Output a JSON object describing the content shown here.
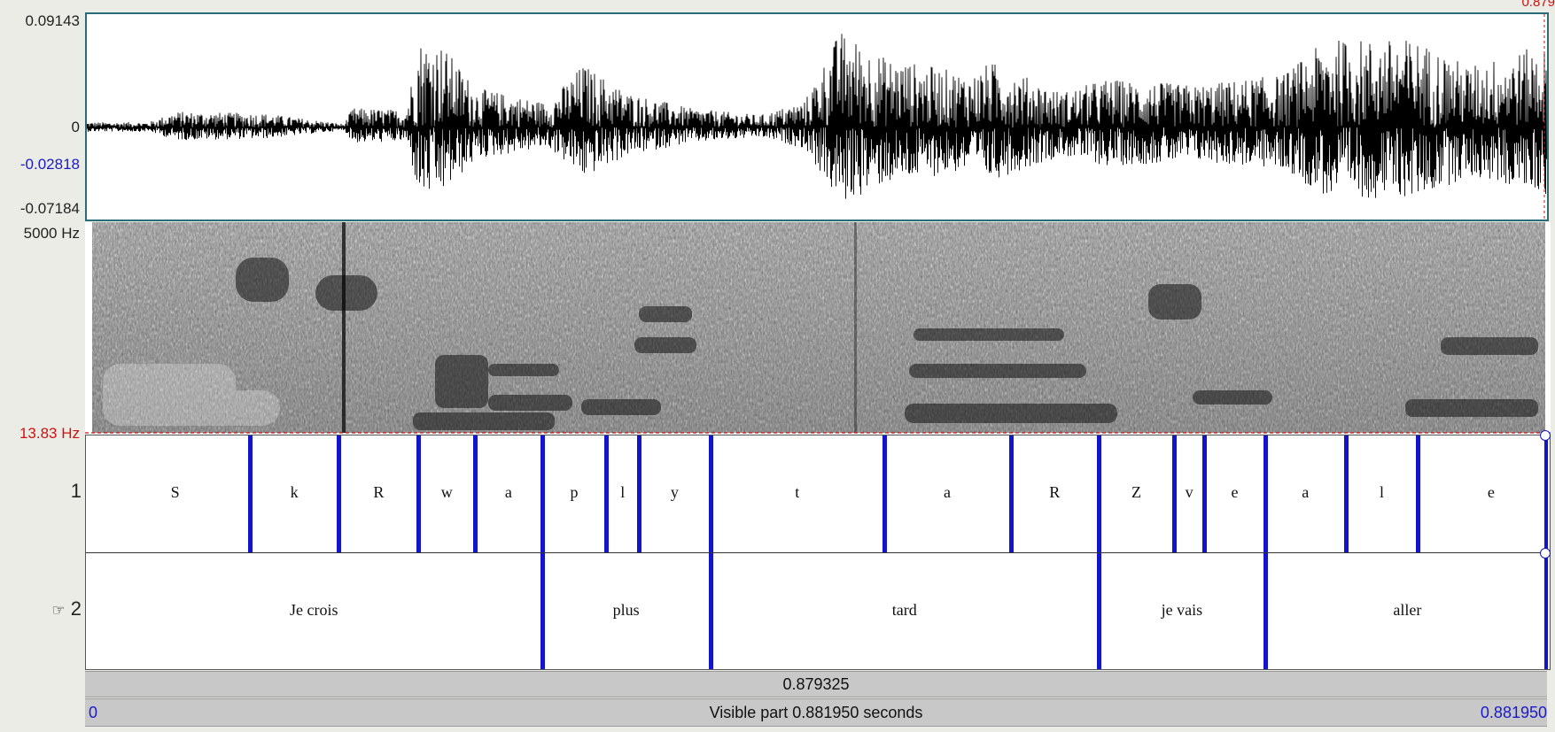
{
  "waveform": {
    "y_max": "0.09143",
    "y_zero": "0",
    "y_cursor": "-0.02818",
    "y_min": "-0.07184",
    "top_right_value": "0.879"
  },
  "spectrogram": {
    "f_max": "5000 Hz",
    "f_min": "13.83 Hz"
  },
  "textgrid": {
    "duration": 0.88195,
    "tiers": [
      {
        "number": "1",
        "pointer": "",
        "boundaries": [
          0.1118,
          0.1728,
          0.2272,
          0.2659,
          0.3115,
          0.3555,
          0.3779,
          0.4266,
          0.5452,
          0.6317,
          0.6919,
          0.7434,
          0.7641,
          0.8056,
          0.8606,
          0.9101
        ],
        "segments": [
          {
            "label": "S",
            "t": 0.0609
          },
          {
            "label": "k",
            "t": 0.1423
          },
          {
            "label": "R",
            "t": 0.2
          },
          {
            "label": "w",
            "t": 0.2465
          },
          {
            "label": "a",
            "t": 0.2887
          },
          {
            "label": "p",
            "t": 0.3335
          },
          {
            "label": "l",
            "t": 0.3667
          },
          {
            "label": "y",
            "t": 0.4022
          },
          {
            "label": "t",
            "t": 0.4859
          },
          {
            "label": "a",
            "t": 0.5884
          },
          {
            "label": "R",
            "t": 0.6618
          },
          {
            "label": "Z",
            "t": 0.7176
          },
          {
            "label": "v",
            "t": 0.7537
          },
          {
            "label": "e",
            "t": 0.7848
          },
          {
            "label": "a",
            "t": 0.8331
          },
          {
            "label": "l",
            "t": 0.8853
          },
          {
            "label": "e",
            "t": 0.96
          }
        ]
      },
      {
        "number": "2",
        "pointer": "☞",
        "boundaries": [
          0.3115,
          0.4266,
          0.6919,
          0.8056
        ],
        "segments": [
          {
            "label": "Je crois",
            "t": 0.1557
          },
          {
            "label": "plus",
            "t": 0.369
          },
          {
            "label": "tard",
            "t": 0.5592
          },
          {
            "label": "je vais",
            "t": 0.7487
          },
          {
            "label": "aller",
            "t": 0.9028
          }
        ]
      }
    ]
  },
  "time_bars": {
    "cursor_time": "0.879325",
    "visible_start": "0",
    "visible_label": "Visible part 0.881950 seconds",
    "visible_end": "0.881950"
  }
}
